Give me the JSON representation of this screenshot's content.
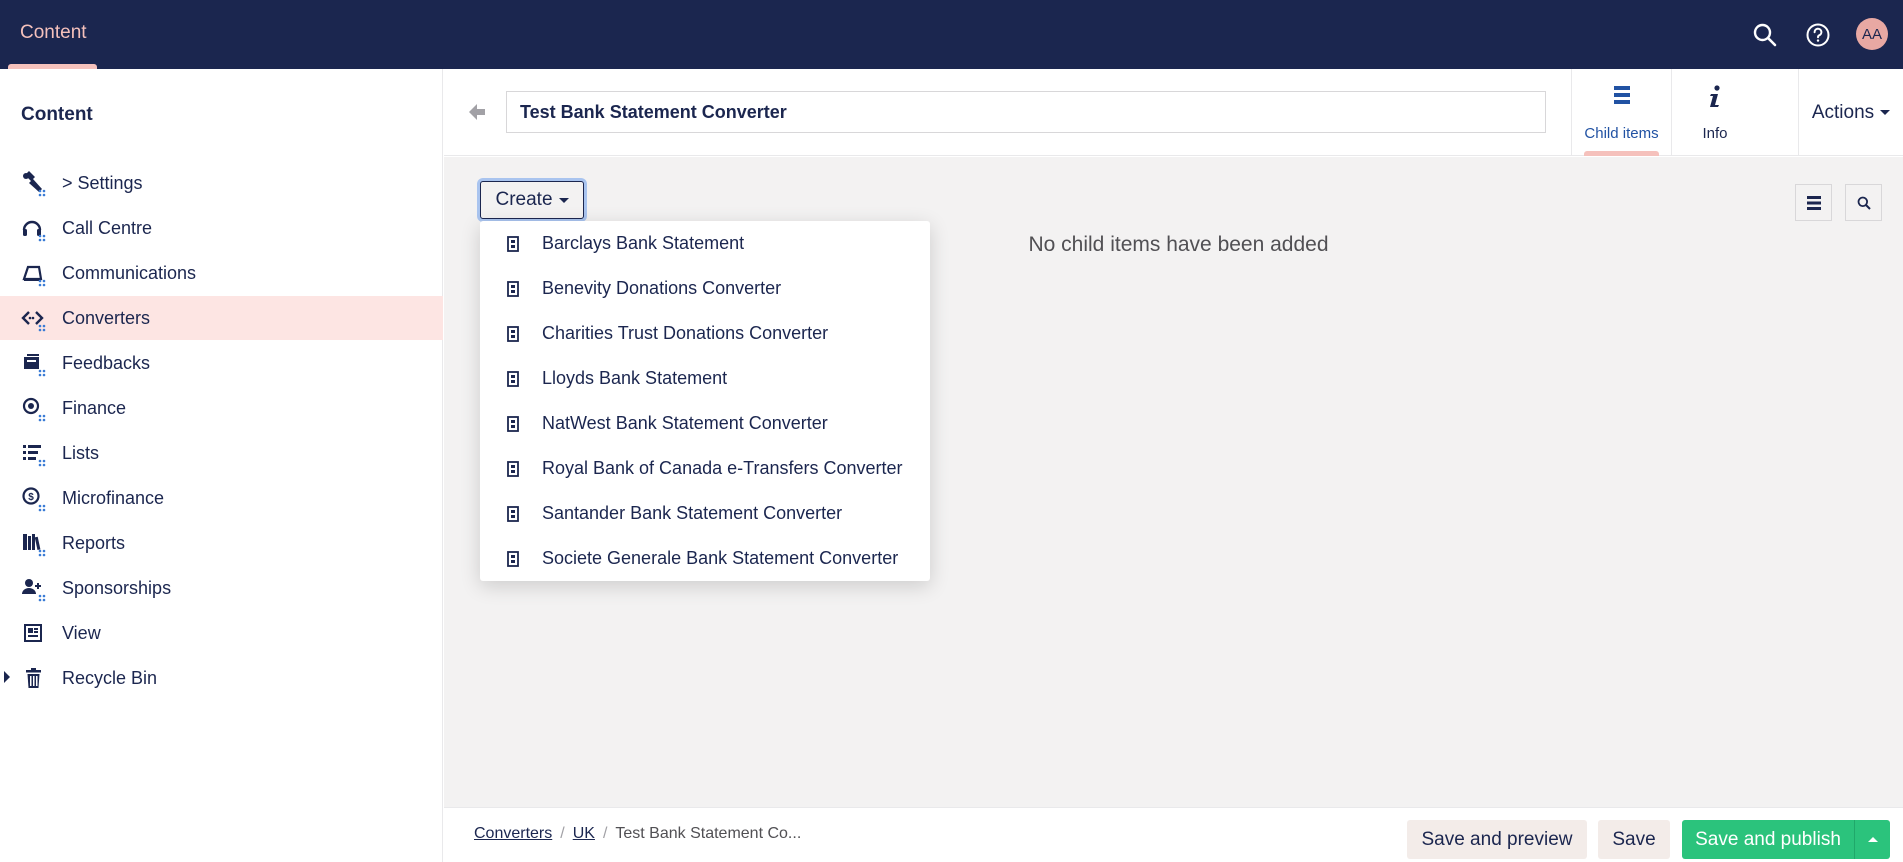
{
  "topbar": {
    "section": "Content",
    "icons": [
      "search-icon",
      "help-icon"
    ],
    "avatar_initials": "AA"
  },
  "sidebar": {
    "title": "Content",
    "items": [
      {
        "label": "> Settings",
        "icon": "wrench-icon"
      },
      {
        "label": "Call Centre",
        "icon": "headset-icon"
      },
      {
        "label": "Communications",
        "icon": "communications-icon"
      },
      {
        "label": "Converters",
        "icon": "code-icon",
        "active": true
      },
      {
        "label": "Feedbacks",
        "icon": "feedback-icon"
      },
      {
        "label": "Finance",
        "icon": "coins-icon"
      },
      {
        "label": "Lists",
        "icon": "list-icon"
      },
      {
        "label": "Microfinance",
        "icon": "coin-icon"
      },
      {
        "label": "Reports",
        "icon": "books-icon"
      },
      {
        "label": "Sponsorships",
        "icon": "users-icon"
      },
      {
        "label": "View",
        "icon": "newspaper-icon"
      },
      {
        "label": "Recycle Bin",
        "icon": "trash-icon"
      }
    ]
  },
  "header": {
    "name_value": "Test Bank Statement Converter",
    "tabs": [
      {
        "label": "Child items",
        "icon": "list-icon",
        "active": true
      },
      {
        "label": "Info",
        "icon": "info-icon"
      }
    ],
    "actions_label": "Actions"
  },
  "main": {
    "create_label": "Create",
    "empty_message": "No child items have been added",
    "create_menu": [
      "Barclays Bank Statement",
      "Benevity Donations Converter",
      "Charities Trust Donations Converter",
      "Lloyds Bank Statement",
      "NatWest Bank Statement Converter",
      "Royal Bank of Canada e-Transfers Converter",
      "Santander Bank Statement Converter",
      "Societe Generale Bank Statement Converter"
    ]
  },
  "footer": {
    "breadcrumb": [
      "Converters",
      "UK",
      "Test Bank Statement Co..."
    ],
    "save_preview_label": "Save and preview",
    "save_label": "Save",
    "save_publish_label": "Save and publish"
  },
  "colors": {
    "nav_bg": "#1b264f",
    "accent_pink": "#f5c1bc",
    "active_row": "#fde5e3",
    "publish_green": "#2bc37c",
    "panel_bg": "#f3f2f2"
  }
}
